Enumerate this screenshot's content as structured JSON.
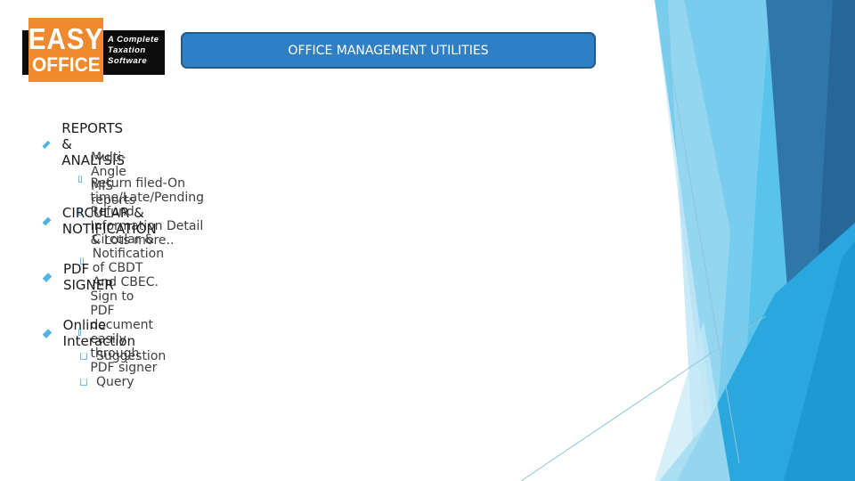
{
  "logo": {
    "line1": "EASY",
    "line2": "OFFICE",
    "tagline": [
      "A Complete",
      "Taxation",
      "Software"
    ]
  },
  "title": "OFFICE MANAGEMENT UTILITIES",
  "sections": [
    {
      "heading": "REPORTS & ANALYSIS",
      "items": [
        "Multi-Angle MIS reports",
        "Return filed-On time/Late/Pending Refund Information Detail & Lots more.."
      ]
    },
    {
      "heading": "CIRCULAR & NOTIFICATION",
      "items": [
        "Circular & Notification of CBDT And CBEC."
      ]
    },
    {
      "heading": "PDF SIGNER",
      "items": [
        "Sign to PDF document easily through PDF signer"
      ]
    },
    {
      "heading": "Online Interaction",
      "items": [
        "Suggestion",
        "Query"
      ]
    }
  ],
  "theme": {
    "accent": "#2e7fc3",
    "bullet": "#4fb3e8",
    "logo_orange": "#ee8a2d"
  }
}
